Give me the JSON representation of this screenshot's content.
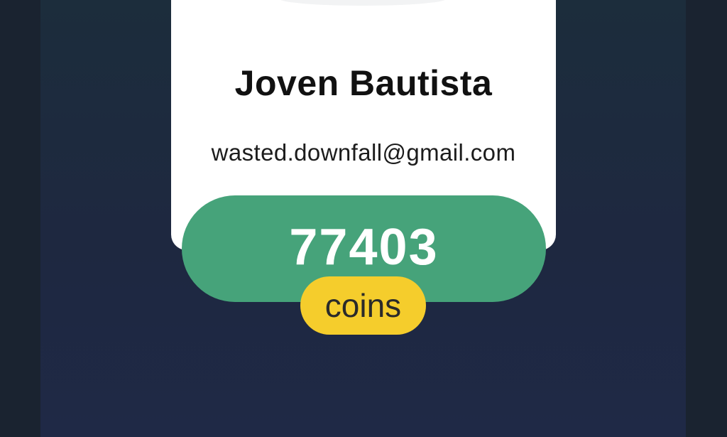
{
  "profile": {
    "name": "Joven Bautista",
    "email": "wasted.downfall@gmail.com"
  },
  "coins": {
    "value": "77403",
    "label": "coins"
  },
  "colors": {
    "background": "#1a2330",
    "card": "#ffffff",
    "coins_pill": "#46a37a",
    "coins_badge": "#f5cd2c",
    "avatar_shirt": "#2aa89b"
  },
  "icons": {
    "avatar": "avatar-illustration"
  }
}
